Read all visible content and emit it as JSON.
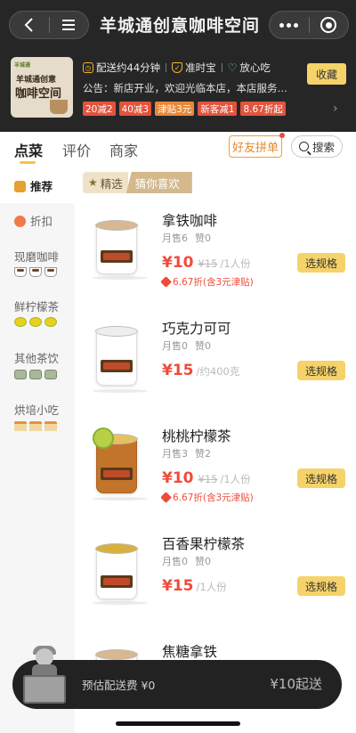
{
  "header": {
    "title": "羊城通创意咖啡空间",
    "back_icon": "back-arrow-icon",
    "menu_icon": "hamburger-menu-icon"
  },
  "store": {
    "logo_text": {
      "brand": "羊城通",
      "line1": "羊城通创意",
      "line2": "咖啡空间"
    },
    "delivery": "配送约44分钟",
    "ontime": "准时宝",
    "safe": "放心吃",
    "collect_label": "收藏",
    "notice": "公告：新店开业，欢迎光临本店，本店服务至...",
    "promo_tags": [
      "20减2",
      "40减3",
      "津贴3元",
      "新客减1",
      "8.67折起"
    ]
  },
  "tabs": {
    "items": [
      "点菜",
      "评价",
      "商家"
    ],
    "active": "点菜",
    "friend_button": "好友拼单",
    "search_button": "搜索"
  },
  "sidebar": {
    "items": [
      {
        "label": "推荐",
        "active": true
      },
      {
        "label": "折扣"
      },
      {
        "label": "现磨咖啡"
      },
      {
        "label": "鲜柠檬茶"
      },
      {
        "label": "其他茶饮"
      },
      {
        "label": "烘培小吃"
      }
    ]
  },
  "section": {
    "left_label": "精选",
    "right_label": "猜你喜欢"
  },
  "products": [
    {
      "name": "拿铁咖啡",
      "sold": "月售6",
      "likes": "赞0",
      "price": "¥10",
      "old_price": "¥15",
      "unit": "/1人份",
      "discount": "6.67折(含3元津贴)",
      "button": "选规格"
    },
    {
      "name": "巧克力可可",
      "sold": "月售0",
      "likes": "赞0",
      "price": "¥15",
      "old_price": "",
      "unit": "/约400克",
      "discount": "",
      "button": "选规格"
    },
    {
      "name": "桃桃柠檬茶",
      "sold": "月售3",
      "likes": "赞2",
      "price": "¥10",
      "old_price": "¥15",
      "unit": "/1人份",
      "discount": "6.67折(含3元津贴)",
      "button": "选规格"
    },
    {
      "name": "百香果柠檬茶",
      "sold": "月售0",
      "likes": "赞0",
      "price": "¥15",
      "old_price": "",
      "unit": "/1人份",
      "discount": "",
      "button": "选规格"
    },
    {
      "name": "焦糖拿铁",
      "sold": "",
      "likes": "",
      "price": "",
      "old_price": "",
      "unit": "",
      "discount": "",
      "button": ""
    }
  ],
  "cart": {
    "delivery_fee": "预估配送费 ¥0",
    "min_order": "¥10起送"
  },
  "colors": {
    "accent": "#f5d36a",
    "price": "#f04b3a",
    "header_bg": "#262626"
  }
}
